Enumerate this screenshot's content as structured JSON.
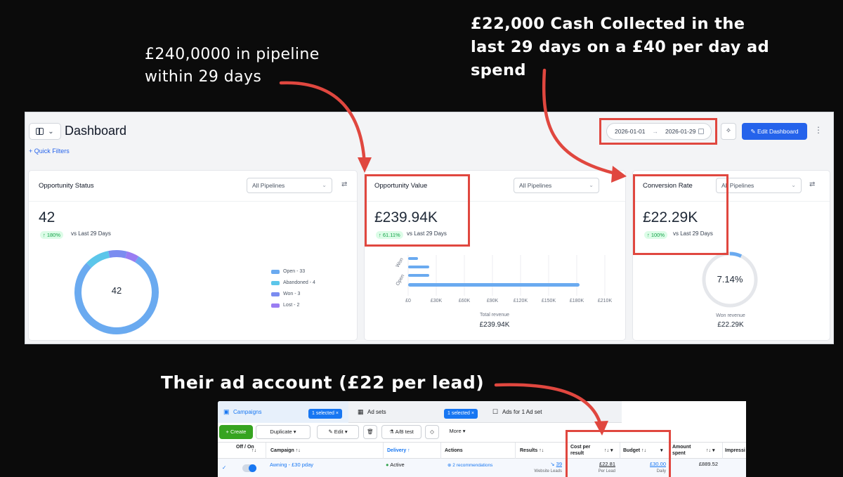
{
  "callouts": {
    "pipeline": "£240,0000 in pipeline within 29 days",
    "cash": "£22,000 Cash Collected in the last 29 days on a £40 per day ad spend",
    "ad_account": "Their ad account (£22 per lead)"
  },
  "colors": {
    "annotation_red": "#e0473f",
    "primary_blue": "#2563eb",
    "background": "#0b0b0b"
  },
  "dashboard": {
    "title": "Dashboard",
    "quick_filters": "+ Quick Filters",
    "date_start": "2026-01-01",
    "date_end": "2026-01-29",
    "edit_button": "Edit Dashboard",
    "cards": {
      "status": {
        "title": "Opportunity Status",
        "pipeline_select": "All Pipelines",
        "value": "42",
        "trend": "↑ 180%",
        "trend_text": "vs Last 29 Days",
        "donut_center": "42",
        "legend": [
          {
            "label": "Open - 33",
            "count": 33,
            "color": "#6aaaf0"
          },
          {
            "label": "Abandoned - 4",
            "count": 4,
            "color": "#5cc6ea"
          },
          {
            "label": "Won - 3",
            "count": 3,
            "color": "#7b8cf0"
          },
          {
            "label": "Lost - 2",
            "count": 2,
            "color": "#9a7df2"
          }
        ]
      },
      "value": {
        "title": "Opportunity Value",
        "pipeline_select": "All Pipelines",
        "value": "£239.94K",
        "trend": "↑ 61.11%",
        "trend_text": "vs Last 29 Days",
        "y_labels": [
          "Won",
          "Open"
        ],
        "x_ticks": [
          "£0",
          "£30K",
          "£60K",
          "£90K",
          "£120K",
          "£150K",
          "£180K",
          "£210K"
        ],
        "caption": "Total revenue",
        "caption_value": "£239.94K"
      },
      "conversion": {
        "title": "Conversion Rate",
        "pipeline_select": "All Pipelines",
        "value": "£22.29K",
        "trend": "↑ 100%",
        "trend_text": "vs Last 29 Days",
        "gauge_label": "7.14%",
        "gauge_fraction": 0.0714,
        "caption": "Won revenue",
        "caption_value": "£22.29K"
      }
    }
  },
  "ads": {
    "tabs": {
      "campaigns": "Campaigns",
      "adsets": "Ad sets",
      "ads": "Ads for 1 Ad set",
      "selected": "1 selected ×"
    },
    "toolbar": {
      "create": "+ Create",
      "duplicate": "Duplicate",
      "edit": "Edit",
      "ab_test": "A/B test",
      "more": "More ▾"
    },
    "columns": {
      "off_on": "Off / On",
      "campaign": "Campaign ↑↓",
      "delivery": "Delivery ↑",
      "actions": "Actions",
      "results": "Results ↑↓",
      "cost_per_result": "Cost per result",
      "budget": "Budget ↑↓",
      "amount_spent": "Amount spent",
      "impressions": "Impressi"
    },
    "row": {
      "campaign": "Awning - £30 pday",
      "delivery": "Active",
      "actions": "2 recommendations",
      "results": "39",
      "results_sub": "Website Leads",
      "cost": "£22.81",
      "cost_sub": "Per Lead",
      "budget": "£30.00",
      "budget_sub": "Daily",
      "amount_spent": "£889.52"
    }
  }
}
